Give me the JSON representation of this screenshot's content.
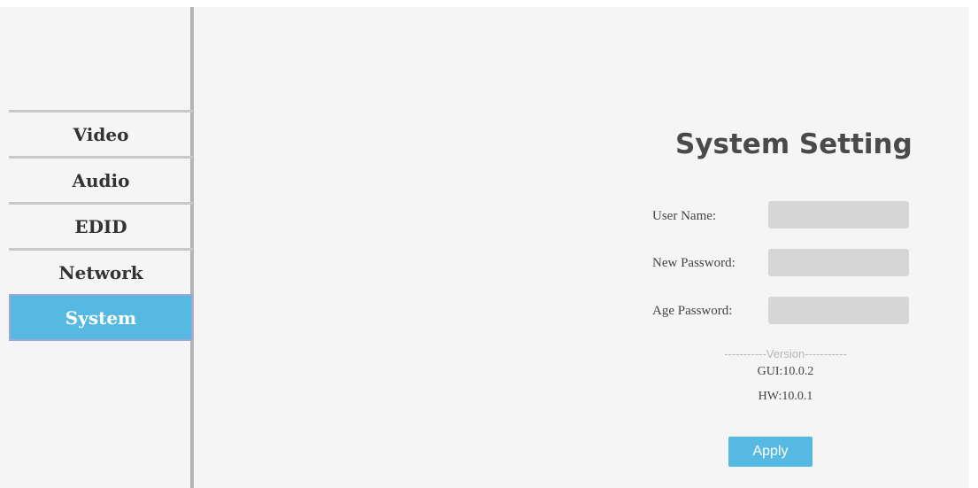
{
  "sidebar": {
    "items": [
      {
        "label": "Video",
        "active": false
      },
      {
        "label": "Audio",
        "active": false
      },
      {
        "label": "EDID",
        "active": false
      },
      {
        "label": "Network",
        "active": false
      },
      {
        "label": "System",
        "active": true
      }
    ]
  },
  "main": {
    "title": "System Setting",
    "form": {
      "user_name": {
        "label": "User Name:",
        "value": ""
      },
      "new_password": {
        "label": "New Password:",
        "value": ""
      },
      "age_password": {
        "label": "Age Password:",
        "value": ""
      }
    },
    "version": {
      "header": "-----------Version-----------",
      "gui": "GUI:10.0.2",
      "hw": "HW:10.0.1"
    },
    "apply_label": "Apply"
  },
  "colors": {
    "accent": "#56b9e2",
    "background": "#f5f5f5",
    "input_fill": "#d6d6d7"
  }
}
